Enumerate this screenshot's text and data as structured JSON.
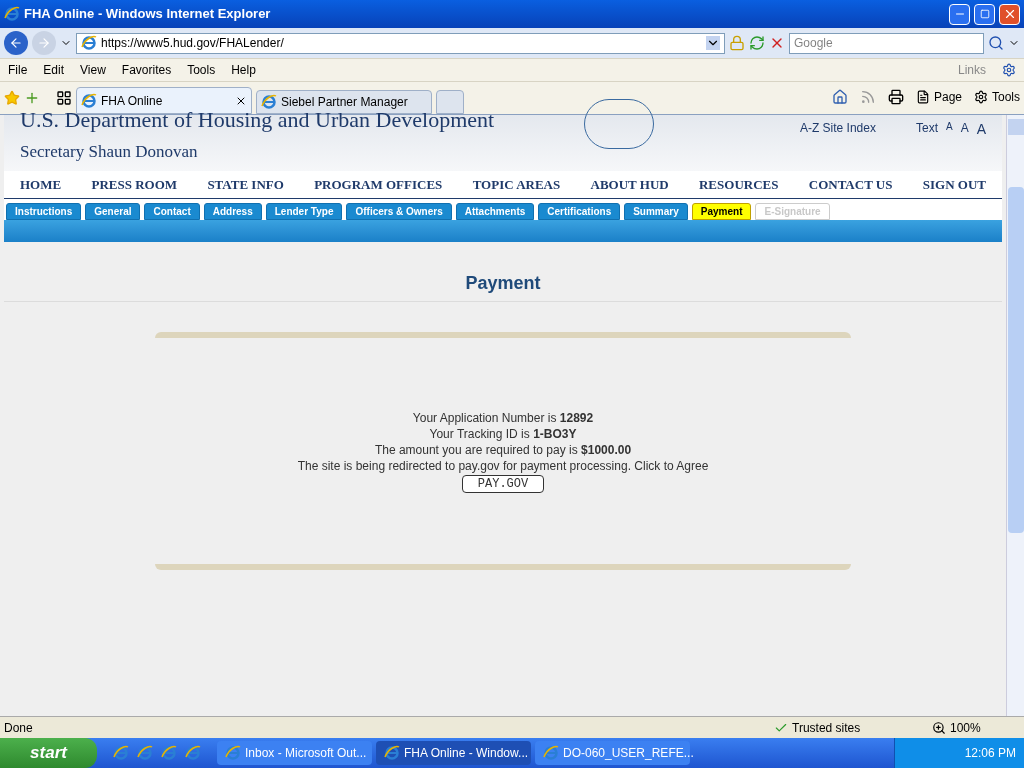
{
  "window": {
    "title": "FHA Online - Windows Internet Explorer"
  },
  "address_bar": {
    "url": "https://www5.hud.gov/FHALender/"
  },
  "search": {
    "placeholder": "Google"
  },
  "menu": [
    "File",
    "Edit",
    "View",
    "Favorites",
    "Tools",
    "Help"
  ],
  "links_label": "Links",
  "browser_tabs": [
    {
      "label": "FHA Online",
      "selected": true
    },
    {
      "label": "Siebel Partner Manager",
      "selected": false
    }
  ],
  "command_bar": {
    "page": "Page",
    "tools": "Tools"
  },
  "page": {
    "header_title": "U.S. Department of Housing and Urban Development",
    "secretary": "Secretary Shaun Donovan",
    "site_index": "A-Z Site Index",
    "text_label": "Text",
    "text_sizes": [
      "A",
      "A",
      "A"
    ],
    "nav": [
      "HOME",
      "PRESS ROOM",
      "STATE INFO",
      "PROGRAM OFFICES",
      "TOPIC AREAS",
      "ABOUT HUD",
      "RESOURCES",
      "CONTACT US",
      "SIGN OUT"
    ],
    "form_tabs": [
      {
        "label": "Instructions",
        "selected": false,
        "disabled": false
      },
      {
        "label": "General",
        "selected": false,
        "disabled": false
      },
      {
        "label": "Contact",
        "selected": false,
        "disabled": false
      },
      {
        "label": "Address",
        "selected": false,
        "disabled": false
      },
      {
        "label": "Lender Type",
        "selected": false,
        "disabled": false
      },
      {
        "label": "Officers & Owners",
        "selected": false,
        "disabled": false
      },
      {
        "label": "Attachments",
        "selected": false,
        "disabled": false
      },
      {
        "label": "Certifications",
        "selected": false,
        "disabled": false
      },
      {
        "label": "Summary",
        "selected": false,
        "disabled": false
      },
      {
        "label": "Payment",
        "selected": true,
        "disabled": false
      },
      {
        "label": "E-Signature",
        "selected": false,
        "disabled": true
      }
    ],
    "heading": "Payment",
    "lines": [
      "Your Application Number is **12892**",
      "Your Tracking ID is **1-BO3Y**",
      "The amount you are required to pay is **$1000.00**",
      "The site is being redirected to pay.gov for payment processing. Click to Agree"
    ],
    "button": "PAY.GOV"
  },
  "status_bar": {
    "status": "Done",
    "zone": "Trusted sites",
    "zoom": "100%"
  },
  "taskbar": {
    "start": "start",
    "tasks": [
      {
        "label": "Inbox - Microsoft Out...",
        "selected": false
      },
      {
        "label": "FHA Online - Window...",
        "selected": true
      },
      {
        "label": "DO-060_USER_REFE...",
        "selected": false
      }
    ],
    "clock": "12:06 PM"
  }
}
